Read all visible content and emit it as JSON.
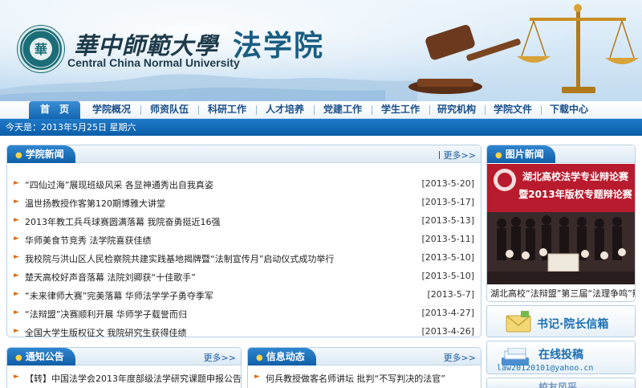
{
  "banner": {
    "university_cn": "華中師範大學",
    "university_en": "Central China Normal University",
    "school_name": "法学院",
    "seal_text": "HUAZHONG NORMAL UNIVERSITY",
    "seal_mark": "華"
  },
  "nav": {
    "items": [
      "首　页",
      "学院概况",
      "师资队伍",
      "科研工作",
      "人才培养",
      "党建工作",
      "学生工作",
      "研究机构",
      "学院文件",
      "下载中心"
    ]
  },
  "datebar": {
    "text": "今天是：2013年5月25日 星期六"
  },
  "college_news": {
    "title": "学院新闻",
    "more": "更多>>",
    "items": [
      {
        "title": "“四仙过海”展现班级风采  各显神通秀出自我真姿",
        "date": "[2013-5-20]"
      },
      {
        "title": "温世扬教授作客第120期博雅大讲堂",
        "date": "[2013-5-17]"
      },
      {
        "title": "2013年教工兵乓球赛圆满落幕  我院奋勇挺近16强",
        "date": "[2013-5-13]"
      },
      {
        "title": "华师美食节竞秀  法学院喜获佳绩",
        "date": "[2013-5-11]"
      },
      {
        "title": "我校院与洪山区人民检察院共建实践基地揭牌暨“法制宣传月”启动仪式成功举行",
        "date": "[2013-5-10]"
      },
      {
        "title": "楚天高校好声音落幕  法院刘卿获“十佳歌手”",
        "date": "[2013-5-10]"
      },
      {
        "title": "“未来律师大赛”完美落幕  华师法学学子勇夺季军",
        "date": "[2013-5-7]"
      },
      {
        "title": "“法辩盟”决赛顺利开展  华师学子载誉而归",
        "date": "[2013-4-27]"
      },
      {
        "title": "全国大学生版权征文  我院研究生获得佳绩",
        "date": "[2013-4-26]"
      }
    ]
  },
  "photo_news": {
    "title": "图片新闻",
    "banner_line1": "湖北高校法学专业辩论赛",
    "banner_line2": "暨2013年版权专题辩论赛",
    "caption": "湖北高校“法辩盟”第三届“法理争鸣”辩论"
  },
  "notices": {
    "title": "通知公告",
    "more": "更多>>",
    "items": [
      {
        "title": "【转】中国法学会2013年度部级法学研究课题申报公告"
      }
    ]
  },
  "info": {
    "title": "信息动态",
    "more": "更多>>",
    "items": [
      {
        "title": "何兵教授做客名师讲坛  批判“不写判决的法官”"
      }
    ]
  },
  "side_links": {
    "mailbox": "书记·院长信箱",
    "submit": "在线投稿",
    "submit_email": "law20120101@yahoo.cn",
    "third": "校友风采"
  },
  "colors": {
    "primary_blue": "#1466b3",
    "bullet_orange": "#e06a12",
    "banner_bg": "#d6e8f6"
  }
}
